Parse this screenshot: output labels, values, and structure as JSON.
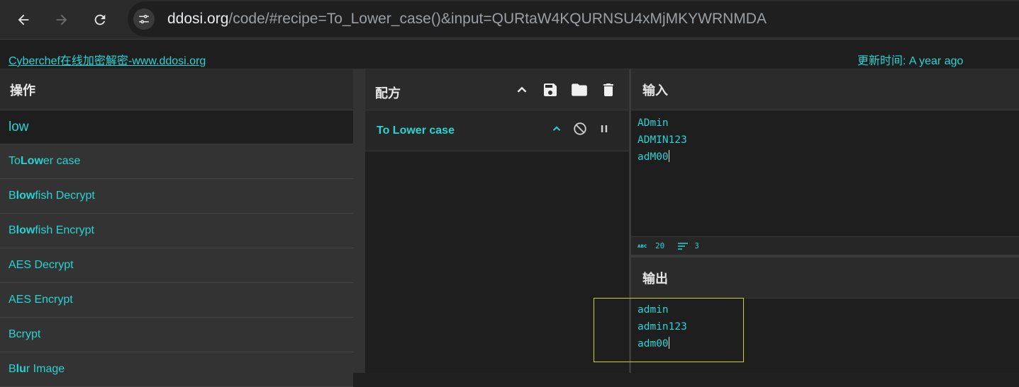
{
  "browser": {
    "url_host": "ddosi.org",
    "url_rest": "/code/#recipe=To_Lower_case()&input=QURtaW4KQURNSU4xMjMKYWRNMDA"
  },
  "banner": {
    "site_link": "Cyberchef在线加密解密-www.ddosi.org",
    "updated": "更新时间: A year ago"
  },
  "operations": {
    "title": "操作",
    "search_value": "low",
    "items": [
      {
        "pre": "To ",
        "match": "Low",
        "post": "er case"
      },
      {
        "pre": "B",
        "match": "low",
        "post": "fish Decrypt"
      },
      {
        "pre": "B",
        "match": "low",
        "post": "fish Encrypt"
      },
      {
        "pre": "AES Decrypt",
        "match": "",
        "post": ""
      },
      {
        "pre": "AES Encrypt",
        "match": "",
        "post": ""
      },
      {
        "pre": "Bcrypt",
        "match": "",
        "post": ""
      },
      {
        "pre": "B",
        "match": "lu",
        "post": "r Image"
      }
    ]
  },
  "recipe": {
    "title": "配方",
    "operation_name": "To Lower case"
  },
  "input": {
    "title": "输入",
    "lines": [
      "ADmin",
      "ADMIN123",
      "adM00"
    ],
    "char_count": "20",
    "line_count": "3"
  },
  "output": {
    "title": "输出",
    "lines": [
      "admin",
      "admin123",
      "adm00"
    ]
  },
  "colors": {
    "accent": "#2ad3d3",
    "highlight_box": "#c8d41f"
  }
}
